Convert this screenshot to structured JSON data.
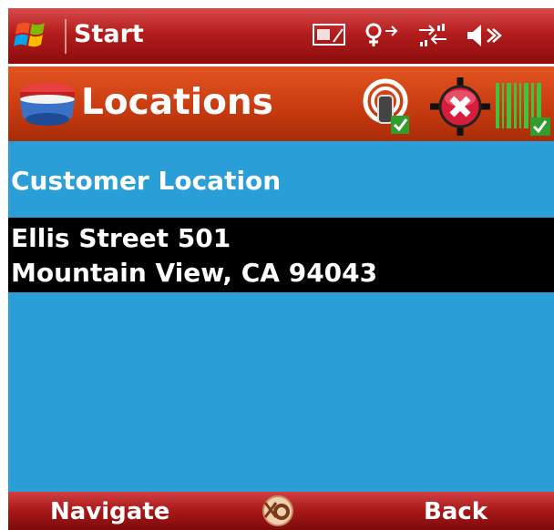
{
  "statusbar": {
    "start_label": "Start",
    "icons": [
      "windows-flag-icon",
      "phone-signal-icon",
      "connectivity-icon",
      "data-transfer-icon",
      "speaker-icon"
    ]
  },
  "header": {
    "title": "Locations",
    "icons": [
      "app-logo-icon",
      "gps-status-icon",
      "close-icon",
      "barcode-scanner-icon"
    ]
  },
  "content": {
    "section_title": "Customer Location",
    "address": {
      "street": "Ellis Street 501",
      "city_line": "Mountain View, CA 94043"
    }
  },
  "softkeys": {
    "left": "Navigate",
    "right": "Back",
    "center_icon": "keyboard-icon"
  },
  "colors": {
    "statusbar": "#b31d1d",
    "header": "#c63a10",
    "content_bg": "#2a9ed6",
    "selection_bg": "#000000",
    "text": "#ffffff"
  }
}
